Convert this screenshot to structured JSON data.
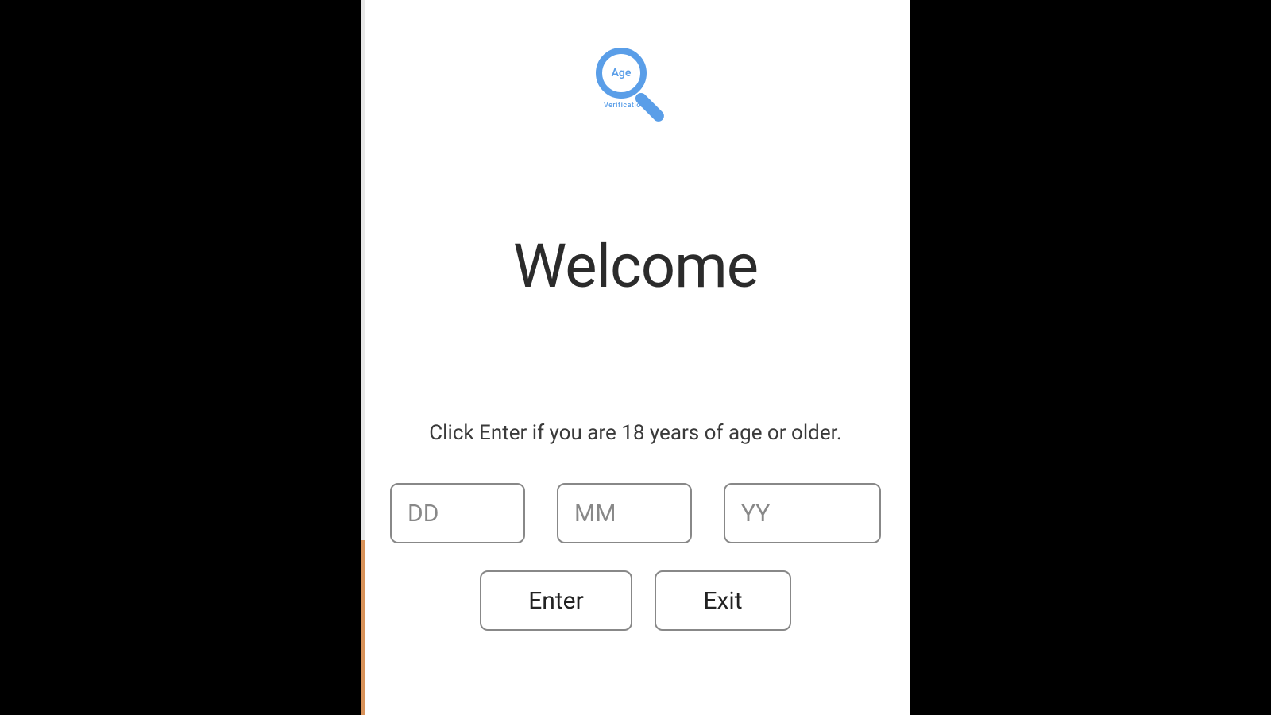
{
  "logo": {
    "lens_text": "Age",
    "sub_text": "Verification"
  },
  "heading": "Welcome",
  "subtext": "Click Enter if you are 18 years of age or older.",
  "inputs": {
    "day_placeholder": "DD",
    "month_placeholder": "MM",
    "year_placeholder": "YY"
  },
  "buttons": {
    "enter_label": "Enter",
    "exit_label": "Exit"
  }
}
